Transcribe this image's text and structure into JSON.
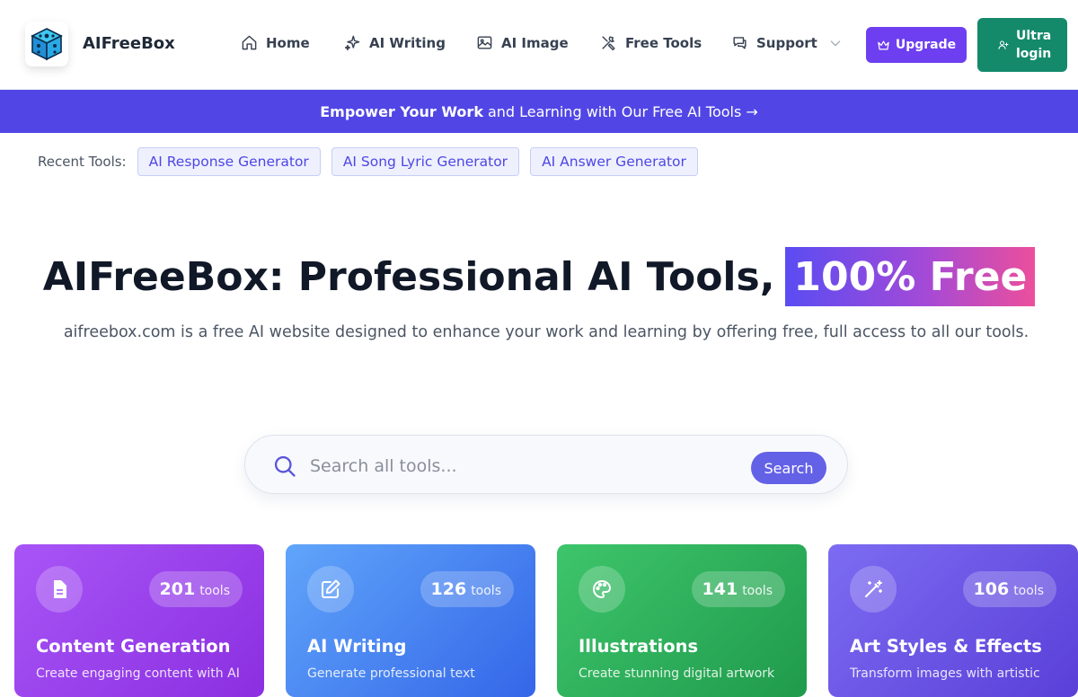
{
  "brand": {
    "name": "AIFreeBox"
  },
  "nav": [
    {
      "label": "Home",
      "icon": "home-icon"
    },
    {
      "label": "AI Writing",
      "icon": "sparkles-icon"
    },
    {
      "label": "AI Image",
      "icon": "image-icon"
    },
    {
      "label": "Free Tools",
      "icon": "tools-icon"
    },
    {
      "label": "Support",
      "icon": "chat-icon"
    }
  ],
  "header_buttons": {
    "upgrade": "Upgrade",
    "login_line1": "Ultra",
    "login_line2": "login"
  },
  "banner": {
    "bold": "Empower Your Work",
    "rest": "and Learning with Our Free AI Tools",
    "arrow": "→"
  },
  "recent": {
    "label": "Recent Tools:",
    "items": [
      "AI Response Generator",
      "AI Song Lyric Generator",
      "AI Answer Generator"
    ]
  },
  "hero": {
    "title": "AIFreeBox: Professional AI Tools,",
    "highlight": "100% Free",
    "subtitle": "aifreebox.com is a free AI website designed to enhance your work and learning by offering free, full access to all our tools."
  },
  "search": {
    "placeholder": "Search all tools...",
    "button": "Search"
  },
  "categories": [
    {
      "title": "Content Generation",
      "count": "201",
      "unit": "tools",
      "desc": "Create engaging content with AI",
      "icon": "document-icon",
      "gradient": [
        "#a855f7",
        "#8b2fe0"
      ]
    },
    {
      "title": "AI Writing",
      "count": "126",
      "unit": "tools",
      "desc": "Generate professional text",
      "icon": "edit-icon",
      "gradient": [
        "#60a5fa",
        "#3466e8"
      ]
    },
    {
      "title": "Illustrations",
      "count": "141",
      "unit": "tools",
      "desc": "Create stunning digital artwork",
      "icon": "palette-icon",
      "gradient": [
        "#3ec56b",
        "#1f9a4c"
      ]
    },
    {
      "title": "Art Styles & Effects",
      "count": "106",
      "unit": "tools",
      "desc": "Transform images with artistic",
      "icon": "magic-wand-icon",
      "gradient": [
        "#7c6cf2",
        "#5a3fd8"
      ]
    }
  ],
  "colors": {
    "accent": "#5146e5",
    "upgrade": "#6d3ff0",
    "login": "#148a6b"
  }
}
